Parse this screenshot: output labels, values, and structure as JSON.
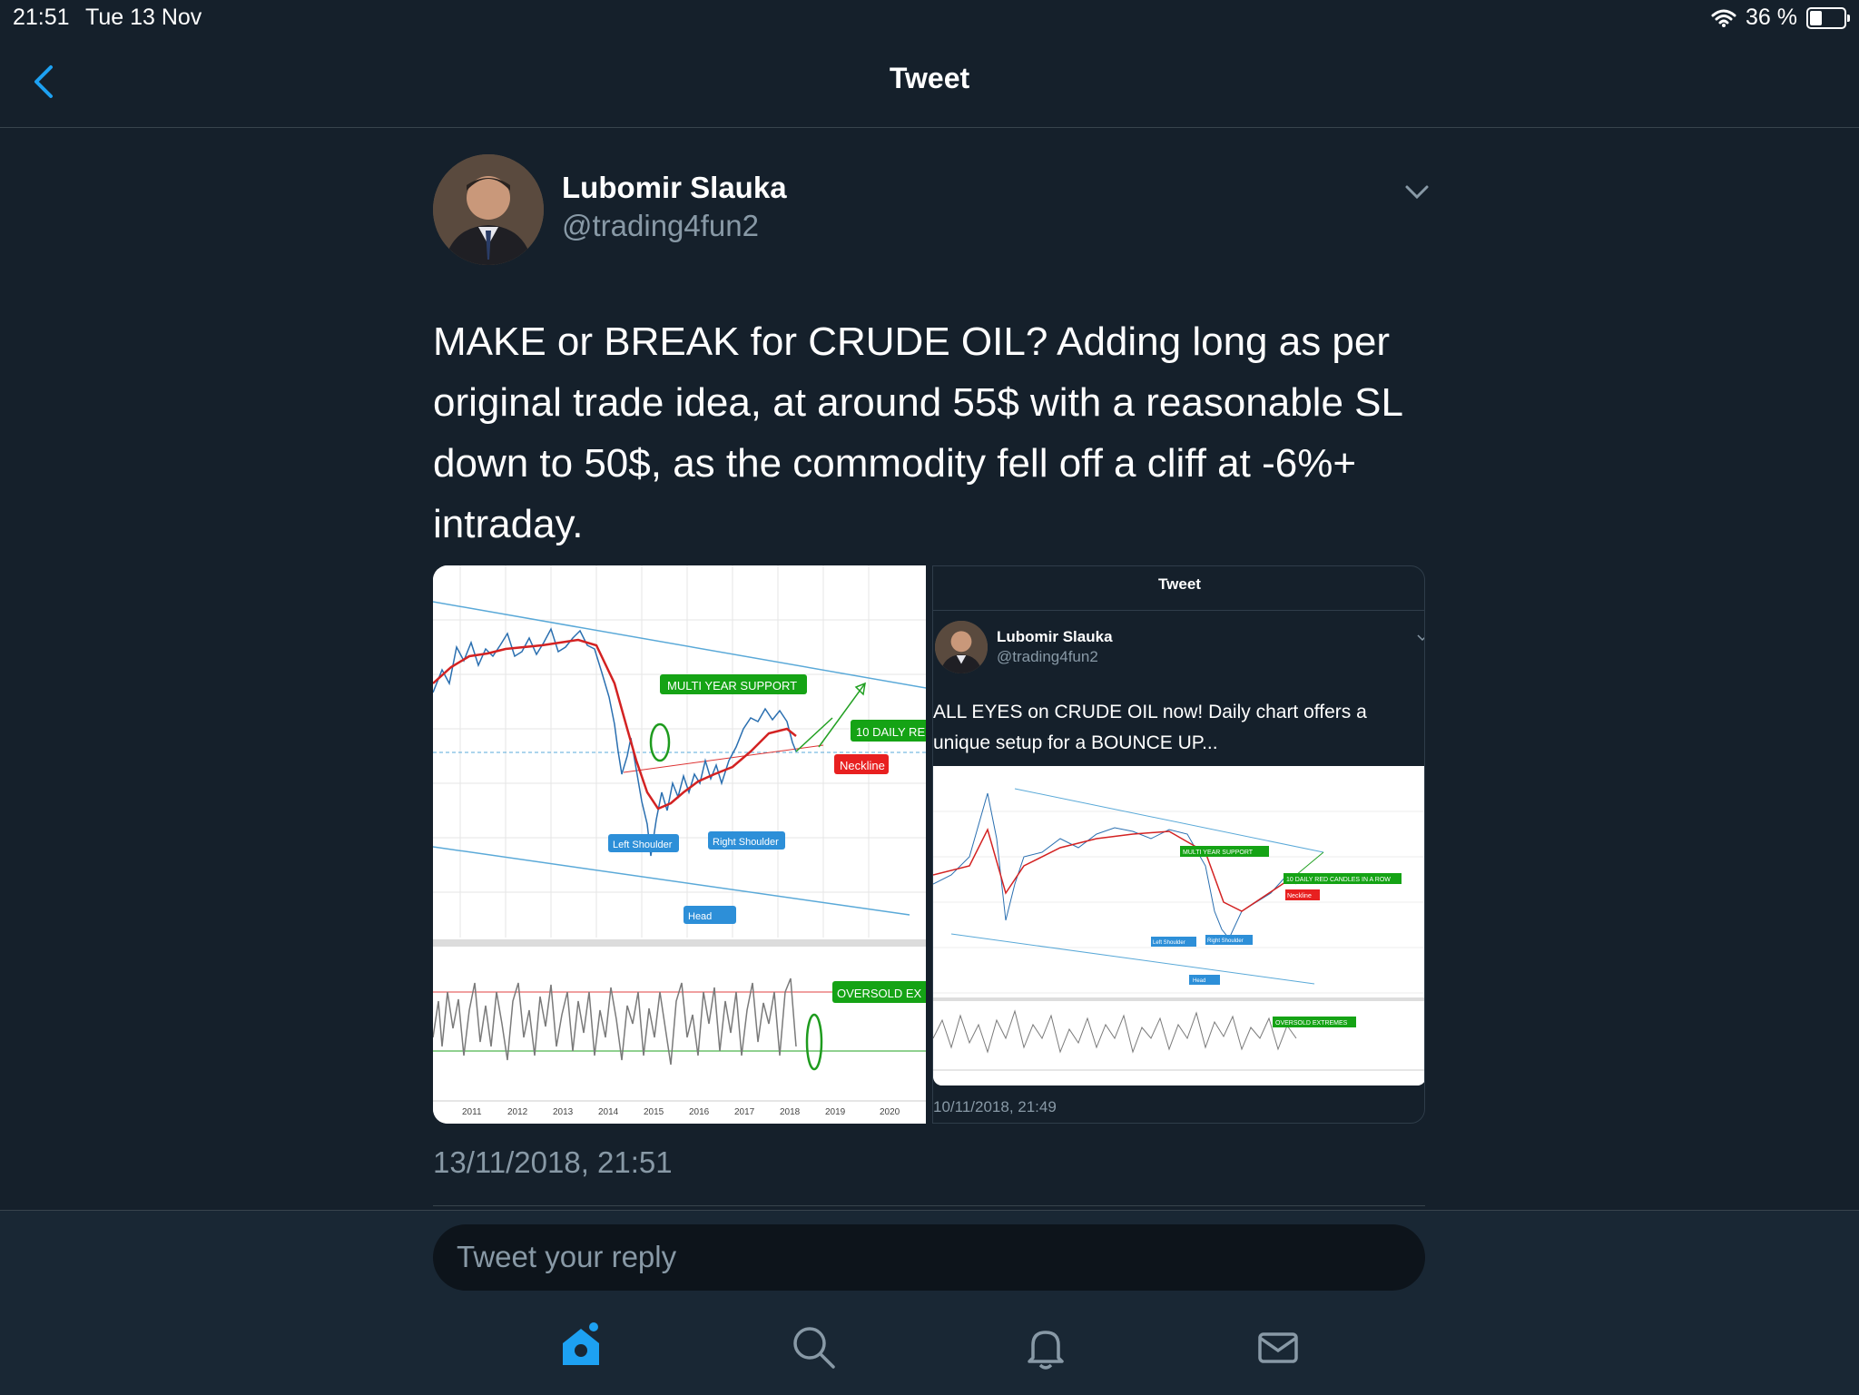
{
  "status_bar": {
    "time": "21:51",
    "date": "Tue 13 Nov",
    "battery": "36 %"
  },
  "nav": {
    "title": "Tweet",
    "back_icon": "chevron-left-icon"
  },
  "tweet": {
    "author_name": "Lubomir Slauka",
    "author_handle": "@trading4fun2",
    "text": "MAKE or BREAK for CRUDE OIL? Adding long as per original trade idea, at around 55$ with a reasonable SL down to 50$, as the commodity fell off a cliff at -6%+ intraday.",
    "timestamp": "13/11/2018, 21:51"
  },
  "chart_left": {
    "labels": {
      "multi_year_support": "MULTI YEAR SUPPORT",
      "daily_red": "10 DAILY RE",
      "neckline": "Neckline",
      "left_shoulder": "Left Shoulder",
      "right_shoulder": "Right Shoulder",
      "head": "Head",
      "oversold": "OVERSOLD EX"
    },
    "years": [
      "2011",
      "2012",
      "2013",
      "2014",
      "2015",
      "2016",
      "2017",
      "2018",
      "2019",
      "2020"
    ]
  },
  "embedded": {
    "title": "Tweet",
    "author_name": "Lubomir Slauka",
    "author_handle": "@trading4fun2",
    "text": "ALL EYES on CRUDE OIL now! Daily chart offers a unique setup for a BOUNCE UP...",
    "timestamp": "10/11/2018, 21:49",
    "chart_labels": {
      "multi_year_support": "MULTI YEAR SUPPORT",
      "daily_red": "10 DAILY RED CANDLES IN A ROW",
      "neckline": "Neckline",
      "left_shoulder": "Left Shoulder",
      "right_shoulder": "Right Shoulder",
      "head": "Head",
      "oversold": "OVERSOLD EXTREMES"
    }
  },
  "reply": {
    "placeholder": "Tweet your reply"
  },
  "tabs": [
    {
      "icon": "home-icon",
      "active": true
    },
    {
      "icon": "search-icon",
      "active": false
    },
    {
      "icon": "bell-icon",
      "active": false
    },
    {
      "icon": "mail-icon",
      "active": false
    }
  ],
  "colors": {
    "background": "#15202b",
    "accent": "#1da1f2",
    "muted": "#8899a6"
  }
}
